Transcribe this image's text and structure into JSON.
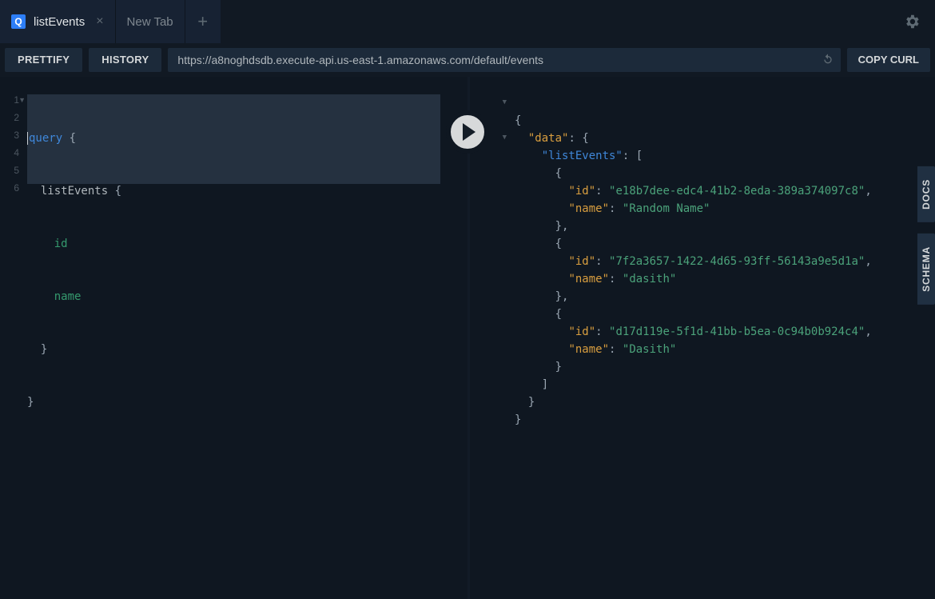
{
  "tabs": [
    {
      "label": "listEvents",
      "hasIcon": true
    },
    {
      "label": "New Tab",
      "hasIcon": false
    }
  ],
  "toolbar": {
    "prettify": "PRETTIFY",
    "history": "HISTORY",
    "url": "https://a8noghdsdb.execute-api.us-east-1.amazonaws.com/default/events",
    "copy_curl": "COPY CURL"
  },
  "side": {
    "docs": "DOCS",
    "schema": "SCHEMA"
  },
  "query": {
    "lines": [
      "1",
      "2",
      "3",
      "4",
      "5",
      "6"
    ],
    "kw": "query",
    "op": "listEvents",
    "f1": "id",
    "f2": "name"
  },
  "response": {
    "data_key": "\"data\"",
    "list_key": "\"listEvents\"",
    "id_key": "\"id\"",
    "name_key": "\"name\"",
    "items": [
      {
        "id": "\"e18b7dee-edc4-41b2-8eda-389a374097c8\"",
        "name": "\"Random Name\""
      },
      {
        "id": "\"7f2a3657-1422-4d65-93ff-56143a9e5d1a\"",
        "name": "\"dasith\""
      },
      {
        "id": "\"d17d119e-5f1d-41bb-b5ea-0c94b0b924c4\"",
        "name": "\"Dasith\""
      }
    ]
  }
}
